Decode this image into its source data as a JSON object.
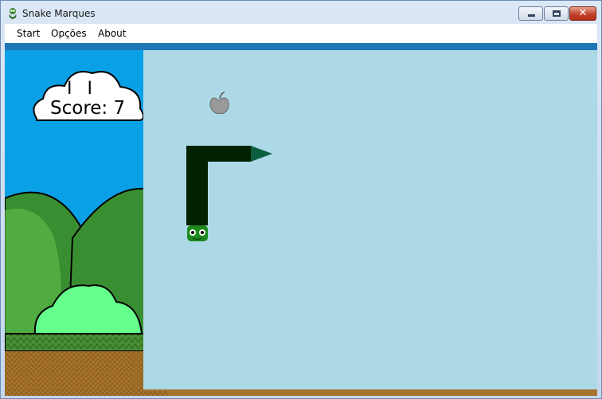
{
  "window": {
    "title": "Snake Marques",
    "app_icon": "snake-icon",
    "controls": {
      "minimize": "minimize-icon",
      "maximize": "maximize-icon",
      "close": "close-icon"
    }
  },
  "menu": {
    "items": [
      {
        "label": "Start"
      },
      {
        "label": "Opções"
      },
      {
        "label": "About"
      }
    ]
  },
  "hud": {
    "pause_glyph": "I I",
    "score_text": "Score: 7",
    "score": 7
  },
  "game": {
    "food": "apple-icon",
    "snake": {
      "head": "snake-head",
      "tail": "snake-tail-arrow"
    }
  },
  "colors": {
    "playfield": "#add8e6",
    "snake_body": "#002200",
    "snake_tail": "#0b5f3f",
    "snake_head": "#1e8a1e",
    "sky": "#0aa0e6",
    "hill_dark": "#3a8e32",
    "hill_light": "#5fbf4a",
    "bush": "#66ff8c",
    "grass": "#3f7f2c",
    "dirt": "#a0702a"
  }
}
